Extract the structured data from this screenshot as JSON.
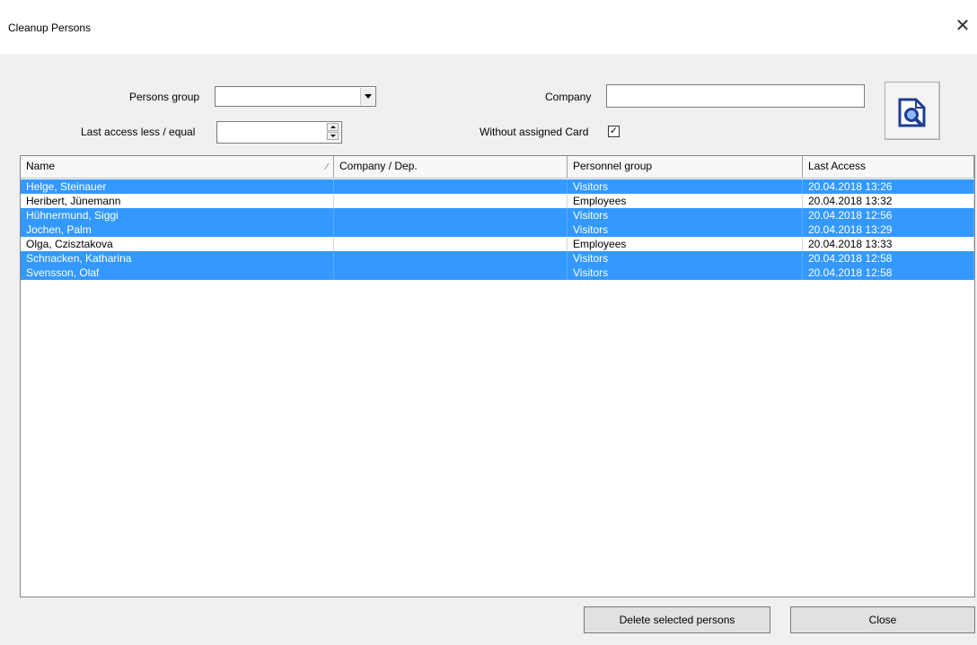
{
  "window": {
    "title": "Cleanup Persons",
    "close_glyph": "✕"
  },
  "filters": {
    "persons_group_label": "Persons group",
    "persons_group_value": "",
    "last_access_label": "Last access less / equal",
    "last_access_value": "",
    "company_label": "Company",
    "company_value": "",
    "without_card_label": "Without assigned Card",
    "without_card_checked": "✓",
    "search_icon": "search-document-icon"
  },
  "table": {
    "columns": [
      "Name",
      "Company / Dep.",
      "Personnel group",
      "Last Access"
    ],
    "sort_indicator": "⁄",
    "rows": [
      {
        "name": "Helge, Steinauer",
        "company": "",
        "group": "Visitors",
        "last_access": "20.04.2018 13:26",
        "selected": true
      },
      {
        "name": "Heribert, Jünemann",
        "company": "",
        "group": "Employees",
        "last_access": "20.04.2018 13:32",
        "selected": false
      },
      {
        "name": "Hühnermund, Siggi",
        "company": "",
        "group": "Visitors",
        "last_access": "20.04.2018 12:56",
        "selected": true
      },
      {
        "name": "Jochen, Palm",
        "company": "",
        "group": "Visitors",
        "last_access": "20.04.2018 13:29",
        "selected": true
      },
      {
        "name": "Olga, Czisztakova",
        "company": "",
        "group": "Employees",
        "last_access": "20.04.2018 13:33",
        "selected": false
      },
      {
        "name": "Schnacken, Katharina",
        "company": "",
        "group": "Visitors",
        "last_access": "20.04.2018 12:58",
        "selected": true
      },
      {
        "name": "Svensson, Olaf",
        "company": "",
        "group": "Visitors",
        "last_access": "20.04.2018 12:58",
        "selected": true
      }
    ]
  },
  "buttons": {
    "delete_label": "Delete selected persons",
    "close_label": "Close"
  },
  "colors": {
    "selection": "#3399ff",
    "background": "#f0f0f0"
  }
}
